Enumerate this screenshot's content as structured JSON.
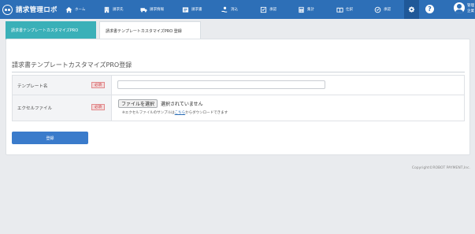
{
  "app": {
    "brand_name": "請求管理ロボ"
  },
  "nav": {
    "items": [
      {
        "label": "ホーム",
        "icon": "home-icon"
      },
      {
        "label": "請求先",
        "icon": "building-icon"
      },
      {
        "label": "請求情報",
        "icon": "truck-icon"
      },
      {
        "label": "請求書",
        "icon": "invoice-icon"
      },
      {
        "label": "消込",
        "icon": "hand-coin-icon"
      },
      {
        "label": "承認",
        "icon": "check-square-icon"
      },
      {
        "label": "集計",
        "icon": "calculator-icon"
      },
      {
        "label": "仕訳",
        "icon": "book-icon"
      },
      {
        "label": "承認",
        "icon": "check-circle-icon"
      }
    ],
    "user_name_line1": "管理",
    "user_name_line2": "企業"
  },
  "tabs": [
    {
      "label": "請求書テンプレートカスタマイズPRO",
      "active": false
    },
    {
      "label": "請求書テンプレートカスタマイズPRO 登録",
      "active": true
    }
  ],
  "panel": {
    "title": "請求書テンプレートカスタマイズPRO登録"
  },
  "form": {
    "required_badge": "必須",
    "template_name_label": "テンプレート名",
    "template_name_value": "",
    "excel_label": "エクセルファイル",
    "file_button_label": "ファイルを選択",
    "file_status": "選択されていません",
    "note_prefix": "※エクセルファイルのサンプルは",
    "note_link": "こちら",
    "note_suffix": "からダウンロードできます",
    "submit_label": "登録"
  },
  "footer": {
    "copyright": "Copyright©ROBOT PAYMENT,Inc."
  },
  "colors": {
    "nav_bg": "#2d6fb7",
    "tab_active_teal": "#3ab0b8",
    "submit_bg": "#3a7bcb",
    "required_red": "#c9383c"
  }
}
